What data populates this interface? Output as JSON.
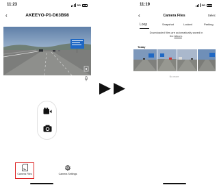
{
  "left_screen": {
    "status": {
      "time": "11:23",
      "network": "5G"
    },
    "title": "AKEEYO-P1-D63B98",
    "tabs": [
      {
        "label": "Camera Files",
        "highlighted": true
      },
      {
        "label": "Camera Settings",
        "highlighted": false
      }
    ],
    "icons": [
      "back-chevron-icon",
      "microphone-icon",
      "video-record-icon",
      "camera-snapshot-icon",
      "sd-card-icon",
      "gear-icon"
    ],
    "highlight_color": "#dd2222"
  },
  "right_screen": {
    "status": {
      "time": "11:19",
      "network": "5G"
    },
    "title": "Camera Files",
    "select_label": "Selec",
    "tabs": [
      "Loop",
      "Snapshot",
      "Locked",
      "Parking"
    ],
    "active_tab": "Loop",
    "info_text": "Downloaded files are automatically saved in",
    "info_text_prefix": "the",
    "info_link": "Album",
    "info_text_suffix": ".",
    "section_title": "Today",
    "thumbnail_count": 4,
    "no_more_text": "No more"
  },
  "transition": {
    "icon": "double-arrow-right-icon"
  }
}
